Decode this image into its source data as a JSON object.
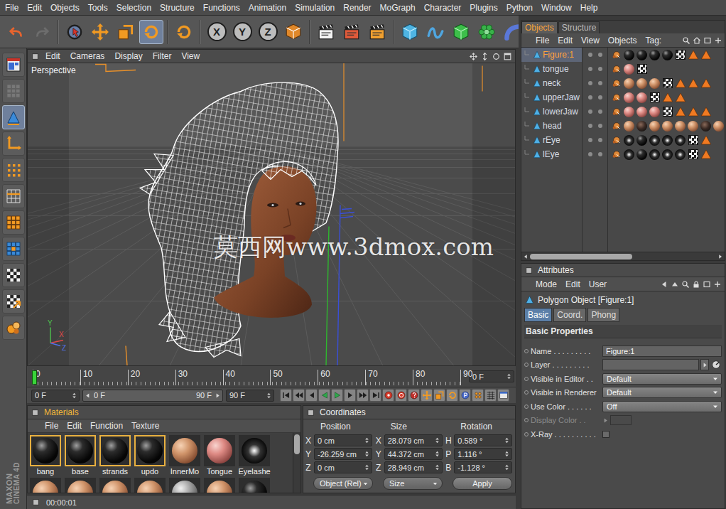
{
  "menu_bar": [
    "File",
    "Edit",
    "Objects",
    "Tools",
    "Selection",
    "Structure",
    "Functions",
    "Animation",
    "Simulation",
    "Render",
    "MoGraph",
    "Character",
    "Plugins",
    "Python",
    "Window",
    "Help"
  ],
  "toolbar": [
    [
      {
        "kind": "undo",
        "selected": false,
        "disabled": false
      },
      {
        "kind": "redo",
        "selected": false,
        "disabled": true
      }
    ],
    [
      {
        "kind": "live-select",
        "selected": false,
        "disabled": false
      },
      {
        "kind": "move",
        "selected": false,
        "disabled": false
      },
      {
        "kind": "scale",
        "selected": false,
        "disabled": false
      },
      {
        "kind": "rotate",
        "selected": true,
        "disabled": false
      }
    ],
    [
      {
        "kind": "recent",
        "selected": false,
        "disabled": false
      }
    ],
    [
      {
        "kind": "axis",
        "label": "X",
        "selected": false,
        "disabled": false
      },
      {
        "kind": "axis",
        "label": "Y",
        "selected": false,
        "disabled": false
      },
      {
        "kind": "axis",
        "label": "Z",
        "selected": false,
        "disabled": false
      },
      {
        "kind": "coord",
        "selected": false,
        "disabled": false
      }
    ],
    [
      {
        "kind": "render-view",
        "selected": false,
        "disabled": false
      },
      {
        "kind": "render-picture",
        "selected": false,
        "disabled": false
      },
      {
        "kind": "render-settings",
        "selected": false,
        "disabled": false
      }
    ],
    [
      {
        "kind": "cube",
        "selected": false,
        "disabled": false
      },
      {
        "kind": "spline",
        "selected": false,
        "disabled": false
      },
      {
        "kind": "nurbs",
        "selected": false,
        "disabled": false
      },
      {
        "kind": "array",
        "selected": false,
        "disabled": false
      },
      {
        "kind": "deformer",
        "selected": false,
        "disabled": false
      }
    ]
  ],
  "left_toolbar": [
    {
      "kind": "layout",
      "selected": false
    },
    {
      "kind": "doodle",
      "selected": false
    },
    {
      "kind": "model",
      "selected": true
    },
    {
      "kind": "axis-tool",
      "selected": false
    },
    {
      "kind": "points",
      "selected": false
    },
    {
      "kind": "edges",
      "selected": false
    },
    {
      "kind": "polygons",
      "selected": false
    },
    {
      "kind": "uv",
      "selected": false
    },
    {
      "kind": "texture",
      "selected": false
    },
    {
      "kind": "workplane",
      "selected": false
    },
    {
      "kind": "paint",
      "selected": false
    }
  ],
  "logo": [
    "MAXON",
    "CINEMA 4D"
  ],
  "viewport": {
    "menu": [
      "Edit",
      "Cameras",
      "Display",
      "Filter",
      "View"
    ],
    "label": "Perspective",
    "axis_labels": [
      {
        "label": "Y",
        "color": "#4ec24e"
      },
      {
        "label": "X",
        "color": "#e04848"
      },
      {
        "label": "Z",
        "color": "#5070e8"
      }
    ]
  },
  "watermark": "莫西网www.3dmox.com",
  "timeline": {
    "ticks": [
      "0",
      "10",
      "20",
      "30",
      "40",
      "50",
      "60",
      "70",
      "80",
      "90"
    ],
    "level": 0,
    "current": "0 F"
  },
  "transport": {
    "start": "0 F",
    "range_start": "0 F",
    "range_end": "90 F",
    "end": "90 F",
    "buttons": [
      "first",
      "prev-key",
      "prev-frame",
      "play-reverse",
      "play",
      "next-frame",
      "next-key",
      "last",
      "record",
      "autokey",
      "keyframe-help",
      "key-move",
      "key-scale",
      "key-rotate",
      "key-param",
      "key-pla",
      "timeline-grid",
      "layout-small"
    ]
  },
  "materials": {
    "title": "Materials",
    "menu": [
      "File",
      "Edit",
      "Function",
      "Texture"
    ],
    "swatches": [
      {
        "name": "bang",
        "kind": "black",
        "selected": true
      },
      {
        "name": "base",
        "kind": "black",
        "selected": true
      },
      {
        "name": "strands",
        "kind": "black",
        "selected": true
      },
      {
        "name": "updo",
        "kind": "black",
        "selected": true
      },
      {
        "name": "InnerMo",
        "kind": "skin",
        "selected": false
      },
      {
        "name": "Tongue",
        "kind": "pink",
        "selected": false
      },
      {
        "name": "Eyelashe",
        "kind": "eye",
        "selected": false
      }
    ],
    "swatches_row2": [
      {
        "kind": "skin"
      },
      {
        "kind": "skin"
      },
      {
        "kind": "skin"
      },
      {
        "kind": "skin"
      },
      {
        "kind": "grey"
      },
      {
        "kind": "skin"
      },
      {
        "kind": "black"
      }
    ],
    "scrollbar": {
      "level": 0.35
    }
  },
  "coordinates": {
    "title": "Coordinates",
    "columns": [
      {
        "header": "Position",
        "fields": [
          {
            "axis": "X",
            "value": "0 cm"
          },
          {
            "axis": "Y",
            "value": "-26.259 cm"
          },
          {
            "axis": "Z",
            "value": "0 cm"
          }
        ]
      },
      {
        "header": "Size",
        "fields": [
          {
            "axis": "X",
            "value": "28.079 cm"
          },
          {
            "axis": "Y",
            "value": "44.372 cm"
          },
          {
            "axis": "Z",
            "value": "28.949 cm"
          }
        ]
      },
      {
        "header": "Rotation",
        "fields": [
          {
            "axis": "H",
            "value": "0.589 °"
          },
          {
            "axis": "P",
            "value": "1.116 °"
          },
          {
            "axis": "B",
            "value": "-1.128 °"
          }
        ]
      }
    ],
    "mode": "Object (Rel)",
    "size_mode": "Size",
    "apply": "Apply"
  },
  "status_bar": "00:00:01",
  "objects": {
    "tabs": [
      {
        "label": "Objects",
        "selected": true
      },
      {
        "label": "Structure",
        "selected": false
      }
    ],
    "menu": [
      "File",
      "Edit",
      "View",
      "Objects",
      "Tag:"
    ],
    "rows": [
      {
        "name": "Figure:1",
        "selected": true,
        "tags": [
          "phong",
          "black",
          "black",
          "black",
          "black",
          "checker",
          "warn",
          "warn"
        ]
      },
      {
        "name": "tongue",
        "selected": false,
        "tags": [
          "phong",
          "pink",
          "checker"
        ]
      },
      {
        "name": "neck",
        "selected": false,
        "tags": [
          "phong",
          "skin",
          "skin",
          "skin",
          "checker",
          "warn",
          "warn",
          "warn"
        ]
      },
      {
        "name": "upperJaw",
        "selected": false,
        "tags": [
          "phong",
          "pink",
          "pink",
          "checker",
          "warn",
          "warn"
        ]
      },
      {
        "name": "lowerJaw",
        "selected": false,
        "tags": [
          "phong",
          "pink",
          "pink",
          "pink",
          "checker",
          "warn",
          "warn",
          "warn"
        ]
      },
      {
        "name": "head",
        "selected": false,
        "tags": [
          "phong",
          "skin",
          "dark",
          "skin",
          "skin",
          "skin",
          "skin",
          "dark",
          "skin"
        ]
      },
      {
        "name": "rEye",
        "selected": false,
        "tags": [
          "phong",
          "eye",
          "black",
          "eye",
          "eye",
          "eye",
          "checker",
          "warn"
        ]
      },
      {
        "name": "lEye",
        "selected": false,
        "tags": [
          "phong",
          "eye",
          "black",
          "eye",
          "eye",
          "eye",
          "checker",
          "warn"
        ]
      }
    ],
    "scrollbar": {
      "level": 0.55
    }
  },
  "attributes": {
    "title": "Attributes",
    "menu": [
      "Mode",
      "Edit",
      "User"
    ],
    "object": "Polygon Object [Figure:1]",
    "tabs": [
      {
        "label": "Basic",
        "selected": true
      },
      {
        "label": "Coord.",
        "selected": false
      },
      {
        "label": "Phong",
        "selected": false
      }
    ],
    "section": "Basic Properties",
    "fields": [
      {
        "kind": "text",
        "label": "Name . . . . . . . . .",
        "value": "Figure:1",
        "disabled": false
      },
      {
        "kind": "layer",
        "label": "Layer . . . . . . . . .",
        "disabled": false
      },
      {
        "kind": "dropdown",
        "label": "Visible in Editor . .",
        "value": "Default",
        "disabled": false
      },
      {
        "kind": "dropdown",
        "label": "Visible in Renderer",
        "value": "Default",
        "disabled": false
      },
      {
        "kind": "dropdown",
        "label": "Use Color . . . . . .",
        "value": "Off",
        "disabled": false
      },
      {
        "kind": "color",
        "label": "Display Color . .",
        "disabled": true
      },
      {
        "kind": "checkbox",
        "label": "X-Ray . . . . . . . . . .",
        "checked": false,
        "disabled": false
      }
    ]
  }
}
